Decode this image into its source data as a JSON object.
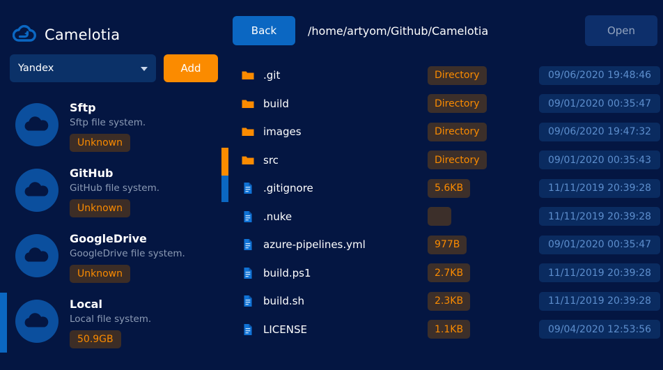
{
  "app": {
    "title": "Camelotia",
    "logo_icon": "cloud-logo-icon"
  },
  "sidebar": {
    "provider_select": {
      "value": "Yandex",
      "arrow_icon": "chevron-down-icon"
    },
    "add_label": "Add",
    "items": [
      {
        "name": "Sftp",
        "description": "Sftp file system.",
        "badge": "Unknown",
        "avatar_icon": "cloud-avatar-icon"
      },
      {
        "name": "GitHub",
        "description": "GitHub file system.",
        "badge": "Unknown",
        "avatar_icon": "cloud-avatar-icon"
      },
      {
        "name": "GoogleDrive",
        "description": "GoogleDrive file system.",
        "badge": "Unknown",
        "avatar_icon": "cloud-avatar-icon"
      },
      {
        "name": "Local",
        "description": "Local file system.",
        "badge": "50.9GB",
        "avatar_icon": "cloud-avatar-icon"
      }
    ]
  },
  "toolbar": {
    "back_label": "Back",
    "path": "/home/artyom/Github/Camelotia",
    "open_label": "Open"
  },
  "files": [
    {
      "name": ".git",
      "type": "folder",
      "size": "Directory",
      "modified": "09/06/2020 19:48:46",
      "icon": "folder-icon"
    },
    {
      "name": "build",
      "type": "folder",
      "size": "Directory",
      "modified": "09/01/2020 00:35:47",
      "icon": "folder-icon"
    },
    {
      "name": "images",
      "type": "folder",
      "size": "Directory",
      "modified": "09/06/2020 19:47:32",
      "icon": "folder-icon"
    },
    {
      "name": "src",
      "type": "folder",
      "size": "Directory",
      "modified": "09/01/2020 00:35:43",
      "icon": "folder-icon"
    },
    {
      "name": ".gitignore",
      "type": "file",
      "size": "5.6KB",
      "modified": "11/11/2019 20:39:28",
      "icon": "file-icon"
    },
    {
      "name": ".nuke",
      "type": "file",
      "size": "",
      "modified": "11/11/2019 20:39:28",
      "icon": "file-icon"
    },
    {
      "name": "azure-pipelines.yml",
      "type": "file",
      "size": "977B",
      "modified": "09/01/2020 00:35:47",
      "icon": "file-icon"
    },
    {
      "name": "build.ps1",
      "type": "file",
      "size": "2.7KB",
      "modified": "11/11/2019 20:39:28",
      "icon": "file-icon"
    },
    {
      "name": "build.sh",
      "type": "file",
      "size": "2.3KB",
      "modified": "11/11/2019 20:39:28",
      "icon": "file-icon"
    },
    {
      "name": "LICENSE",
      "type": "file",
      "size": "1.1KB",
      "modified": "09/04/2020 12:53:56",
      "icon": "file-icon"
    }
  ],
  "colors": {
    "background": "#041642",
    "accent_orange": "#fb8b00",
    "accent_blue": "#0b67c2",
    "badge_bg": "#3c2d26",
    "date_bg": "#0a2b60",
    "date_text": "#5d8ecd"
  }
}
